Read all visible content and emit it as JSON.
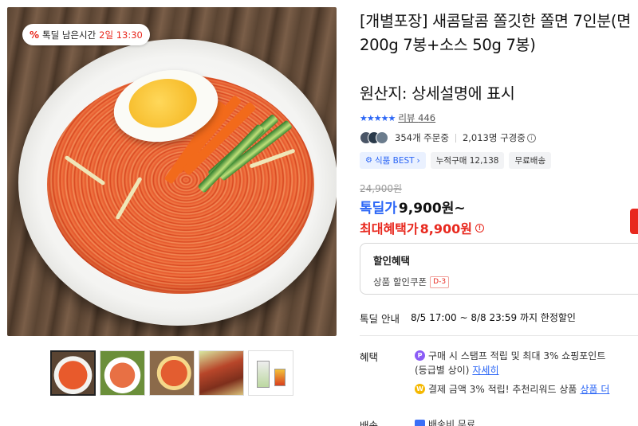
{
  "deal_badge": {
    "label": "톡딜 남은시간",
    "time": "2일 13:30"
  },
  "product": {
    "title": "[개별포장] 새콤달콤 쫄깃한 쫄면 7인분(면 200g 7봉+소스 50g 7봉)",
    "origin": "원산지: 상세설명에 표시"
  },
  "rating": {
    "stars": "★★★★★",
    "review_label": "리뷰",
    "review_count": "446"
  },
  "stats": {
    "orders": "354개 주문중",
    "subscribers": "2,013명 구경중"
  },
  "chips": [
    {
      "label": "식품 BEST",
      "icon": "gear-icon"
    },
    {
      "label": "누적구매 12,138"
    },
    {
      "label": "무료배송"
    }
  ],
  "price": {
    "original": "24,900원",
    "deal_label": "톡딜가",
    "deal_value": "9,900원~",
    "max_label": "최대혜택가",
    "max_value": "8,900원"
  },
  "discount": {
    "header": "할인혜택",
    "item": "상품 할인쿠폰",
    "badge": "D-3"
  },
  "deal_info": {
    "label": "톡딜 안내",
    "value": "8/5 17:00 ~ 8/8 23:59 까지 한정할인"
  },
  "benefit": {
    "label": "혜택",
    "line1": "구매 시 스탬프 적립 및 최대 3% 쇼핑포인트",
    "line1b": "(등급별 상이)",
    "line1_link": "자세히",
    "line2": "결제 금액 3% 적립! 추천리워드 상품",
    "line2_link": "상품 더"
  },
  "shipping": {
    "label": "배송",
    "value": "배송비 무료"
  },
  "colors": {
    "accent": "#2b66f6",
    "deal_red": "#e8281e"
  }
}
